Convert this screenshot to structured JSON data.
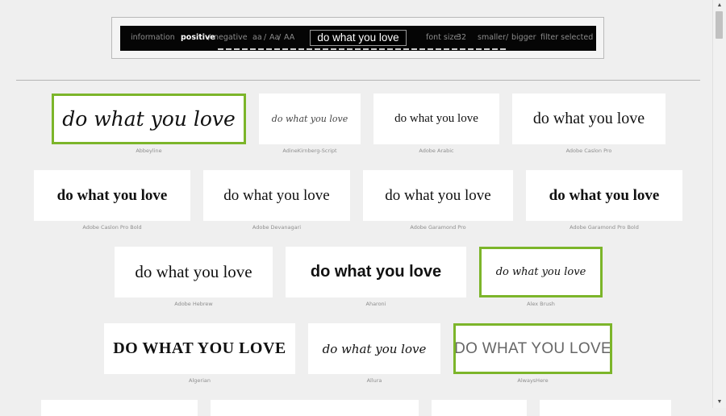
{
  "toolbar": {
    "information": "information",
    "positive": "positive",
    "slash1": "/",
    "negative": "negative",
    "case_lower": "aa",
    "slash2": "/",
    "case_mixed": "Aa",
    "slash3": "/",
    "case_upper": "AA",
    "sample_text": "do what you love",
    "font_size_label": "font size:",
    "font_size_value": "32",
    "smaller": "smaller",
    "slash4": "/",
    "bigger": "bigger",
    "filter": "filter selected"
  },
  "fonts": [
    {
      "sample": "do what you love",
      "name": "Abbeyline",
      "selected": true
    },
    {
      "sample": "do what you love",
      "name": "AdineKirnberg-Script",
      "selected": false
    },
    {
      "sample": "do what you love",
      "name": "Adobe Arabic",
      "selected": false
    },
    {
      "sample": "do what you love",
      "name": "Adobe Caslon Pro",
      "selected": false
    },
    {
      "sample": "do what you love",
      "name": "Adobe Caslon Pro Bold",
      "selected": false
    },
    {
      "sample": "do what you love",
      "name": "Adobe Devanagari",
      "selected": false
    },
    {
      "sample": "do what you love",
      "name": "Adobe Garamond Pro",
      "selected": false
    },
    {
      "sample": "do what you love",
      "name": "Adobe Garamond Pro Bold",
      "selected": false
    },
    {
      "sample": "do what you love",
      "name": "Adobe Hebrew",
      "selected": false
    },
    {
      "sample": "do what you love",
      "name": "Aharoni",
      "selected": false
    },
    {
      "sample": "do what you love",
      "name": "Alex Brush",
      "selected": true
    },
    {
      "sample": "DO WHAT YOU LOVE",
      "name": "Algerian",
      "selected": false
    },
    {
      "sample": "do what you love",
      "name": "Allura",
      "selected": false
    },
    {
      "sample": "DO WHAT YOU LOVE",
      "name": "AlwaysHere",
      "selected": true
    }
  ],
  "colors": {
    "selected_border": "#7cb52a",
    "toolbar_bg": "#050505",
    "page_bg": "#efefef"
  },
  "icons": {
    "scroll_up": "triangle-up-icon",
    "scroll_down": "triangle-down-icon"
  }
}
